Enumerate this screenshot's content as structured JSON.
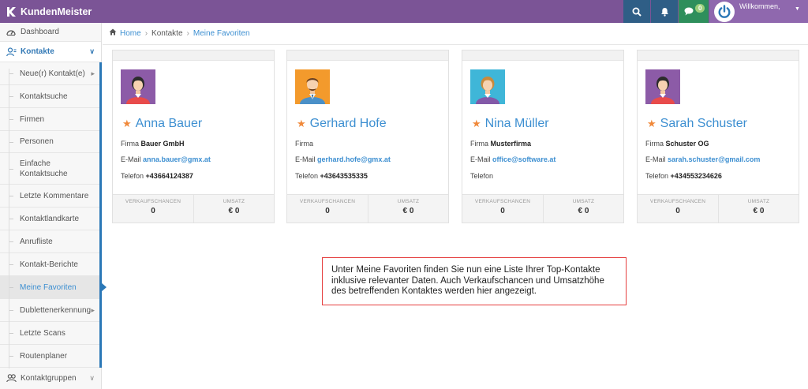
{
  "app": {
    "title": "KundenMeister"
  },
  "topbar": {
    "chat_badge": "0",
    "welcome": "Willkommen,",
    "icons": [
      "search-icon",
      "bell-icon",
      "chat-icon",
      "power-icon"
    ]
  },
  "sidebar": {
    "dashboard": "Dashboard",
    "kontakte": "Kontakte",
    "items": [
      "Neue(r) Kontakt(e)",
      "Kontaktsuche",
      "Firmen",
      "Personen",
      "Einfache Kontaktsuche",
      "Letzte Kommentare",
      "Kontaktlandkarte",
      "Anrufliste",
      "Kontakt-Berichte",
      "Meine Favoriten",
      "Dublettenerkennung",
      "Letzte Scans",
      "Routenplaner"
    ],
    "kontaktgruppen": "Kontaktgruppen"
  },
  "breadcrumb": {
    "home": "Home",
    "kontakte": "Kontakte",
    "current": "Meine Favoriten"
  },
  "cards": [
    {
      "name": "Anna Bauer",
      "firma_label": "Firma",
      "firma": "Bauer GmbH",
      "email_label": "E-Mail",
      "email": "anna.bauer@gmx.at",
      "telefon_label": "Telefon",
      "telefon": "+43664124387",
      "sales_label": "VERKAUFSCHANCEN",
      "sales": "0",
      "revenue_label": "UMSATZ",
      "revenue": "€ 0"
    },
    {
      "name": "Gerhard Hofe",
      "firma_label": "Firma",
      "firma": "",
      "email_label": "E-Mail",
      "email": "gerhard.hofe@gmx.at",
      "telefon_label": "Telefon",
      "telefon": "+43643535335",
      "sales_label": "VERKAUFSCHANCEN",
      "sales": "0",
      "revenue_label": "UMSATZ",
      "revenue": "€ 0"
    },
    {
      "name": "Nina Müller",
      "firma_label": "Firma",
      "firma": "Musterfirma",
      "email_label": "E-Mail",
      "email": "office@software.at",
      "telefon_label": "Telefon",
      "telefon": "",
      "sales_label": "VERKAUFSCHANCEN",
      "sales": "0",
      "revenue_label": "UMSATZ",
      "revenue": "€ 0"
    },
    {
      "name": "Sarah Schuster",
      "firma_label": "Firma",
      "firma": "Schuster OG",
      "email_label": "E-Mail",
      "email": "sarah.schuster@gmail.com",
      "telefon_label": "Telefon",
      "telefon": "+434553234626",
      "sales_label": "VERKAUFSCHANCEN",
      "sales": "0",
      "revenue_label": "UMSATZ",
      "revenue": "€ 0"
    }
  ],
  "note": {
    "text": "Unter Meine Favoriten finden Sie nun eine Liste Ihrer Top-Kontakte inklusive relevanter Daten. Auch Verkaufschancen und Umsatzhöhe des betreffenden Kontaktes werden hier angezeigt."
  },
  "colors": {
    "topbar": "#7b5496",
    "accent": "#3d8fd1",
    "star": "#f0893a",
    "note_border": "#e53f3f"
  }
}
